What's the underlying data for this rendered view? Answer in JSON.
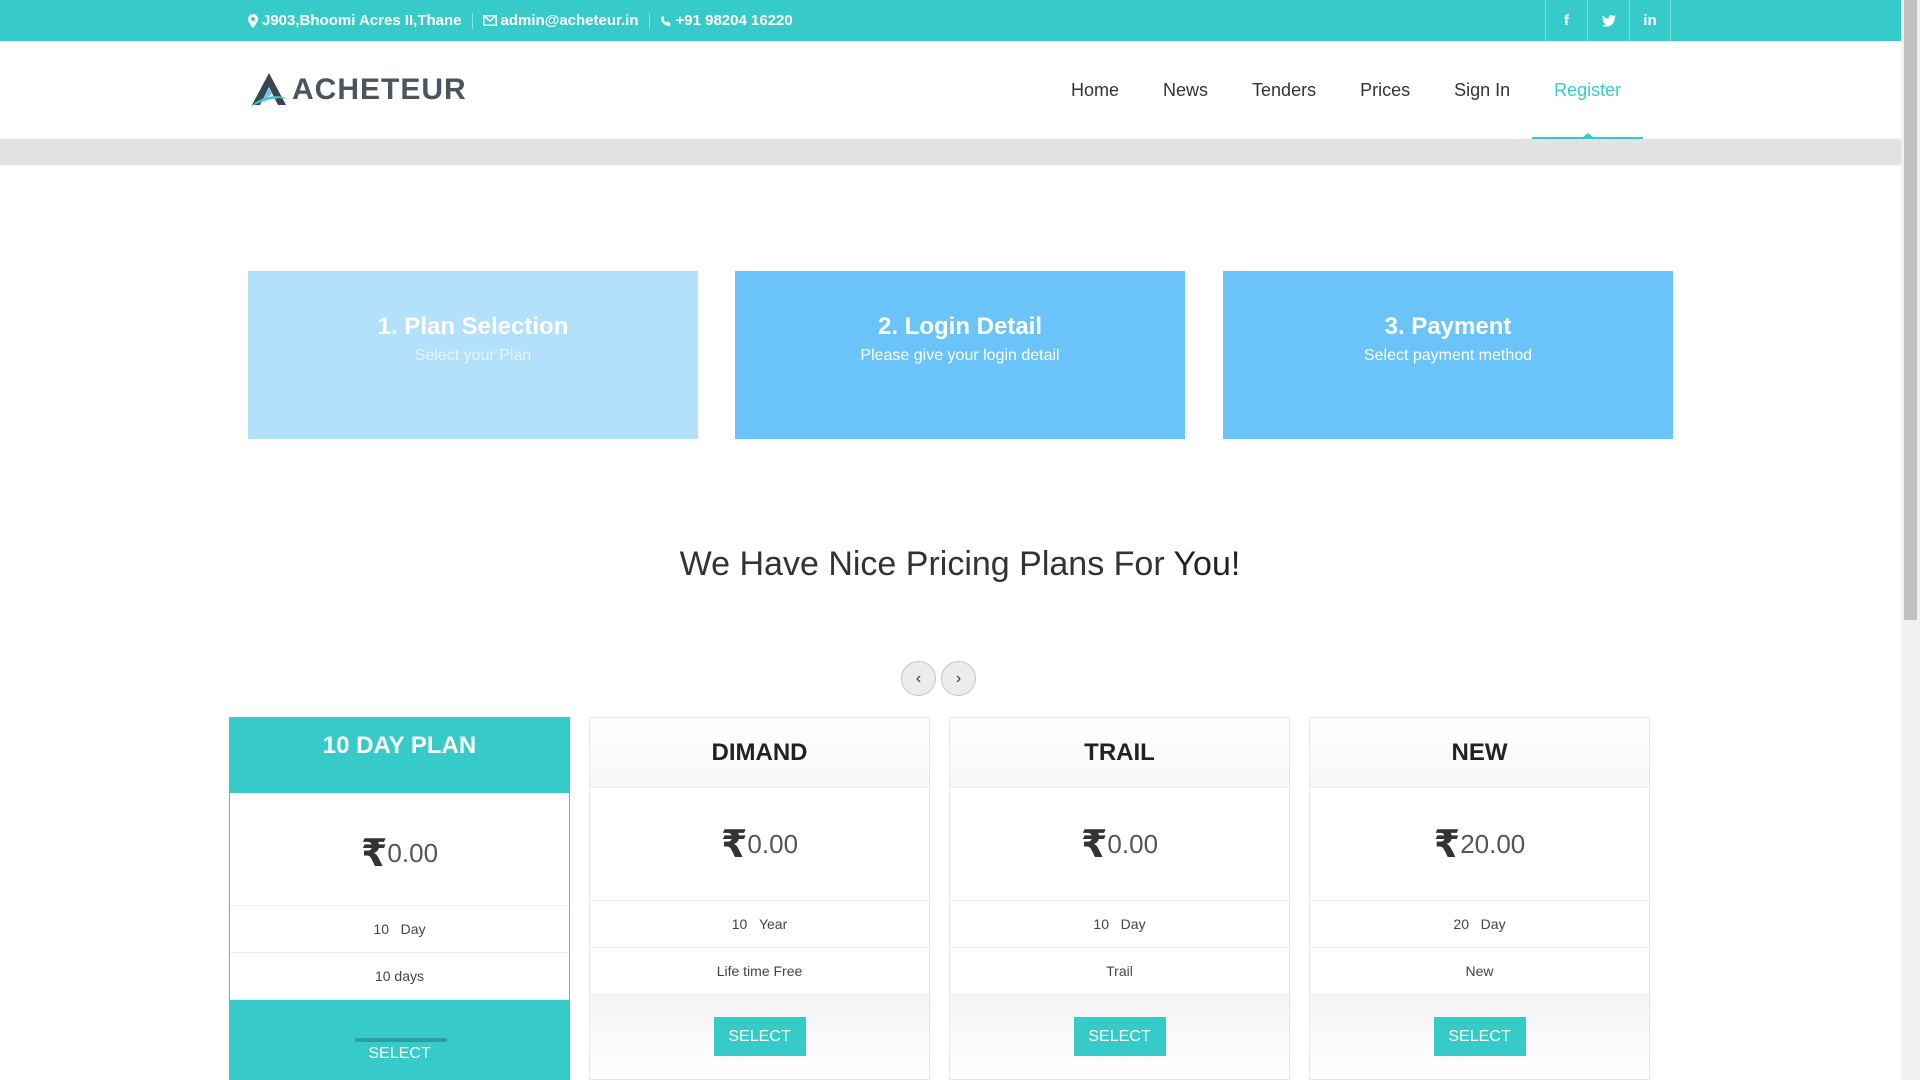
{
  "topbar": {
    "address": "J903,Bhoomi Acres II,Thane",
    "email": "admin@acheteur.in",
    "phone": "+91 98204 16220",
    "social": [
      {
        "icon": "facebook-icon",
        "label": "f"
      },
      {
        "icon": "twitter-icon",
        "label": "t"
      },
      {
        "icon": "linkedin-icon",
        "label": "in"
      }
    ]
  },
  "logo": {
    "text": "ACHETEUR"
  },
  "nav": {
    "items": [
      {
        "label": "Home"
      },
      {
        "label": "News"
      },
      {
        "label": "Tenders"
      },
      {
        "label": "Prices"
      },
      {
        "label": "Sign In"
      },
      {
        "label": "Register"
      }
    ],
    "active": "Register"
  },
  "steps": [
    {
      "title": "1. Plan Selection",
      "subtitle": "Select your Plan"
    },
    {
      "title": "2. Login Detail",
      "subtitle": "Please give your login detail"
    },
    {
      "title": "3. Payment",
      "subtitle": "Select payment method"
    }
  ],
  "heading": {
    "text": "We Have Nice Pricing Plans For ",
    "emphasis": "You!"
  },
  "carousel": {
    "prev": "‹",
    "next": "›"
  },
  "currency_symbol": "₹",
  "plans": [
    {
      "name": "10 DAY PLAN",
      "price": "0.00",
      "duration_value": "10",
      "duration_unit": "Day",
      "description": "10 days",
      "button": "SELECT",
      "featured": true
    },
    {
      "name": "DIMAND",
      "price": "0.00",
      "duration_value": "10",
      "duration_unit": "Year",
      "description": "Life time Free",
      "button": "SELECT"
    },
    {
      "name": "TRAIL",
      "price": "0.00",
      "duration_value": "10",
      "duration_unit": "Day",
      "description": "Trail",
      "button": "SELECT"
    },
    {
      "name": "NEW",
      "price": "20.00",
      "duration_value": "20",
      "duration_unit": "Day",
      "description": "New",
      "button": "SELECT"
    }
  ],
  "colors": {
    "accent": "#36cbc9",
    "step_light": "#b3e0fb",
    "step": "#6ac4fa"
  }
}
